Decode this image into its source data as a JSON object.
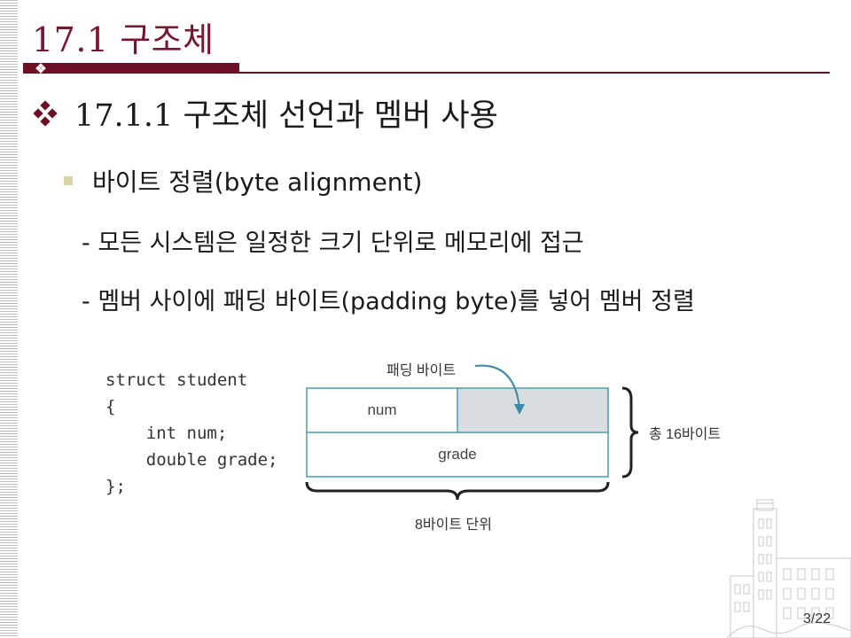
{
  "slide": {
    "title": "17.1 구조체",
    "heading": "17.1.1 구조체 선언과 멤버 사용",
    "subheading": "바이트 정렬(byte alignment)",
    "points": [
      "- 모든 시스템은 일정한 크기 단위로 메모리에 접근",
      "- 멤버 사이에 패딩 바이트(padding byte)를 넣어 멤버 정렬"
    ],
    "code_lines": [
      "struct student",
      "{",
      "    int num;",
      "    double grade;",
      "};"
    ],
    "diagram": {
      "padding_label": "패딩 바이트",
      "cells": {
        "num": "num",
        "grade": "grade"
      },
      "total_label": "총 16바이트",
      "unit_label": "8바이트 단위"
    },
    "page_number": "3/22"
  },
  "colors": {
    "title": "#7a1630",
    "title_bar": "#6b0f24",
    "padding_fill": "#d9dde0",
    "box_border": "#4a9bb5"
  },
  "icons": {
    "heading_bullet": "diamond-cluster-icon",
    "sub_bullet": "square-bullet-icon",
    "building": "building-sketch-icon"
  }
}
